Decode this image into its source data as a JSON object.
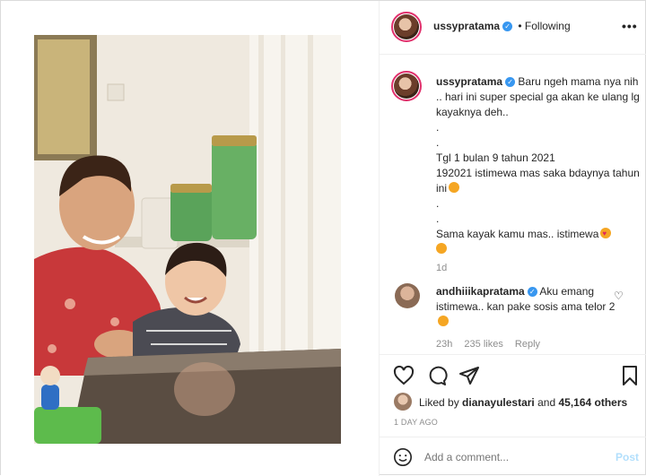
{
  "post": {
    "author": "ussypratama",
    "follow_status": "• Following",
    "more_icon": "more-dots-icon"
  },
  "caption": {
    "username": "ussypratama",
    "lines": [
      "Baru ngeh mama nya nih .. hari ini super special ga akan ke ulang lg kayaknya deh..",
      ".",
      ".",
      "Tgl 1 bulan 9 tahun 2021",
      "192021 istimewa mas saka bdaynya tahun ini",
      ".",
      ".",
      "Sama kayak kamu mas.. istimewa"
    ],
    "time": "1d"
  },
  "comment": {
    "username": "andhiiikapratama",
    "text": "Aku emang istimewa.. kan pake sosis ama telor 2",
    "time": "23h",
    "likes": "235 likes",
    "reply": "Reply"
  },
  "likes": {
    "prefix": "Liked by",
    "liker": "dianayulestari",
    "and": "and",
    "others": "45,164 others"
  },
  "timestamp": "1 DAY AGO",
  "add_comment": {
    "placeholder": "Add a comment...",
    "post_label": "Post"
  },
  "colors": {
    "verified": "#3897f0",
    "link_blue": "#0095f6",
    "muted": "#8e8e8e",
    "border": "#dbdbdb"
  }
}
